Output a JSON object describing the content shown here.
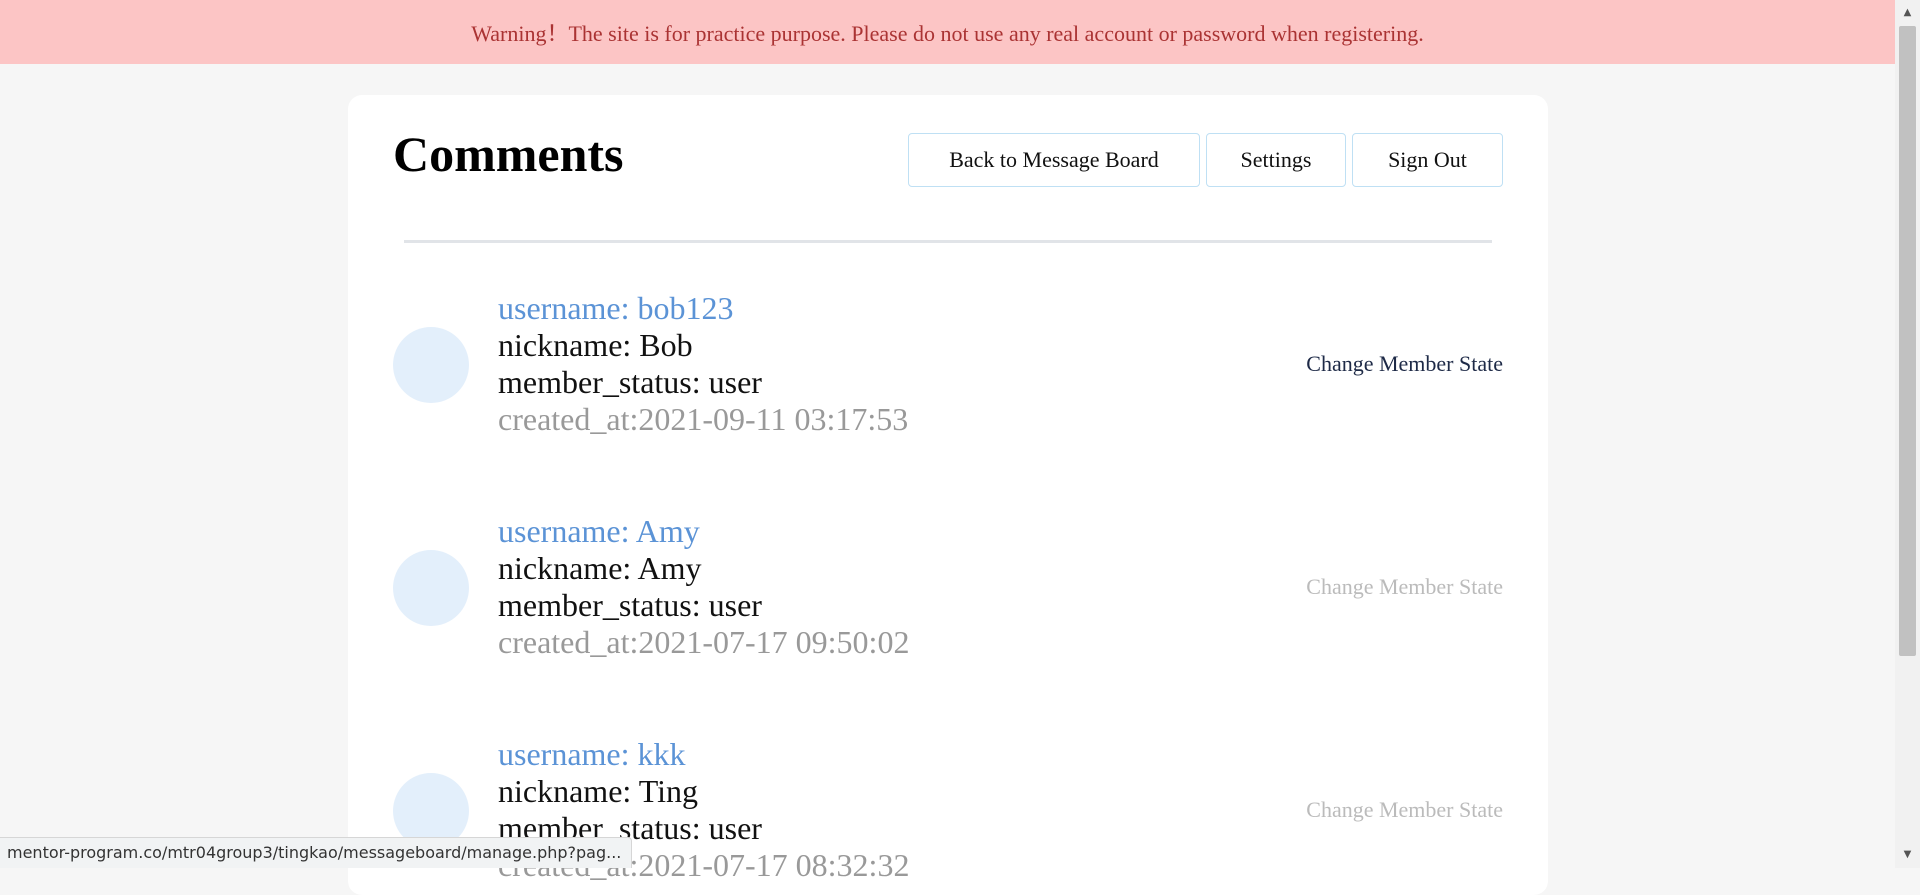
{
  "warning": "Warning！The site is for practice purpose. Please do not use any real account or password when registering.",
  "page_title": "Comments",
  "buttons": {
    "back": "Back to Message Board",
    "settings": "Settings",
    "signout": "Sign Out"
  },
  "members": [
    {
      "username": "username: bob123",
      "nickname": "nickname: Bob",
      "status": "member_status: user",
      "created": "created_at:2021-09-11 03:17:53",
      "action": "Change Member State",
      "action_enabled": true
    },
    {
      "username": "username: Amy",
      "nickname": "nickname: Amy",
      "status": "member_status: user",
      "created": "created_at:2021-07-17 09:50:02",
      "action": "Change Member State",
      "action_enabled": false
    },
    {
      "username": "username: kkk",
      "nickname": "nickname: Ting",
      "status": "member_status: user",
      "created": "created_at:2021-07-17 08:32:32",
      "action": "Change Member State",
      "action_enabled": false
    }
  ],
  "status_url": "mentor-program.co/mtr04group3/tingkao/messageboard/manage.php?pag...",
  "scrollbar": {
    "up_icon": "▲",
    "down_icon": "▼"
  },
  "colors": {
    "warning_bg": "#fcc5c5",
    "warning_text": "#aa3333",
    "username": "#5b93d6",
    "avatar": "#e3effb",
    "action_active": "#1e2a47",
    "action_inactive": "#bbbbbb"
  }
}
